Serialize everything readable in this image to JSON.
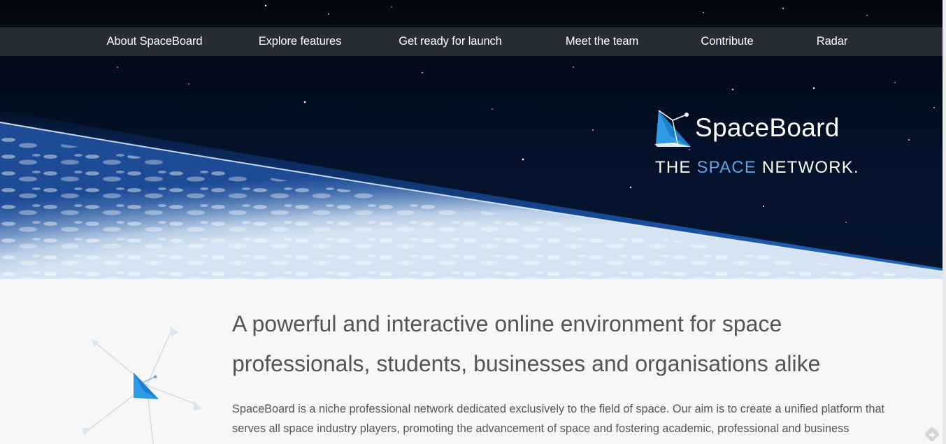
{
  "nav": {
    "items": [
      {
        "label": "About SpaceBoard"
      },
      {
        "label": "Explore features"
      },
      {
        "label": "Get ready for launch"
      },
      {
        "label": "Meet the team"
      },
      {
        "label": "Contribute"
      },
      {
        "label": "Radar"
      }
    ]
  },
  "brand": {
    "name": "SpaceBoard",
    "tagline_prefix": "THE ",
    "tagline_accent": "SPACE",
    "tagline_suffix": " NETWORK."
  },
  "main": {
    "headline": "A powerful and interactive online environment for space professionals, students, businesses and organisations alike",
    "paragraph": "SpaceBoard is a niche professional network dedicated exclusively to the field of space. Our aim is to create a unified platform that serves all space industry players, promoting the advancement of space and fostering academic, professional and business"
  },
  "colors": {
    "accent": "#5aa6e6",
    "logo_blue": "#2e9be6",
    "nav_bar": "#464a52",
    "text": "#555555",
    "background": "#f7f7f7"
  },
  "icons": {
    "logo": "spaceboard-logo-icon",
    "network": "network-illustration-icon",
    "corner": "diamond-arrow-icon"
  }
}
